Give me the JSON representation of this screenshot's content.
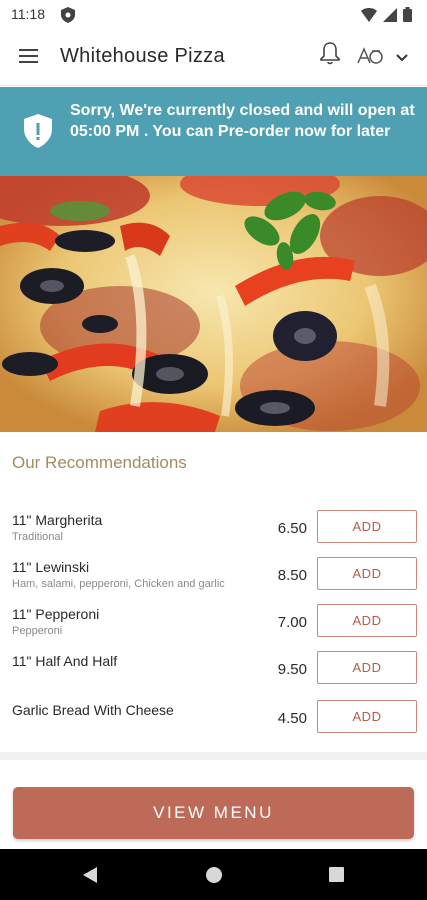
{
  "status_bar": {
    "time": "11:18"
  },
  "app_bar": {
    "title": "Whitehouse Pizza"
  },
  "banner": {
    "message": "Sorry, We're currently closed and will open at 05:00 PM . You can Pre-order now for later"
  },
  "recommendations": {
    "title": "Our Recommendations",
    "items": [
      {
        "name": "11\" Margherita",
        "description": "Traditional",
        "price": "6.50",
        "button": "ADD"
      },
      {
        "name": "11\" Lewinski",
        "description": "Ham, salami, pepperoni, Chicken and garlic",
        "price": "8.50",
        "button": "ADD"
      },
      {
        "name": "11\" Pepperoni",
        "description": "Pepperoni",
        "price": "7.00",
        "button": "ADD"
      },
      {
        "name": "11\" Half And Half",
        "description": "",
        "price": "9.50",
        "button": "ADD"
      },
      {
        "name": "Garlic Bread With Cheese",
        "description": "",
        "price": "4.50",
        "button": "ADD"
      }
    ]
  },
  "footer": {
    "view_menu_label": "VIEW MENU"
  },
  "colors": {
    "banner": "#4fa0b3",
    "accent": "#bd6b58",
    "section_title": "#a48b62"
  }
}
